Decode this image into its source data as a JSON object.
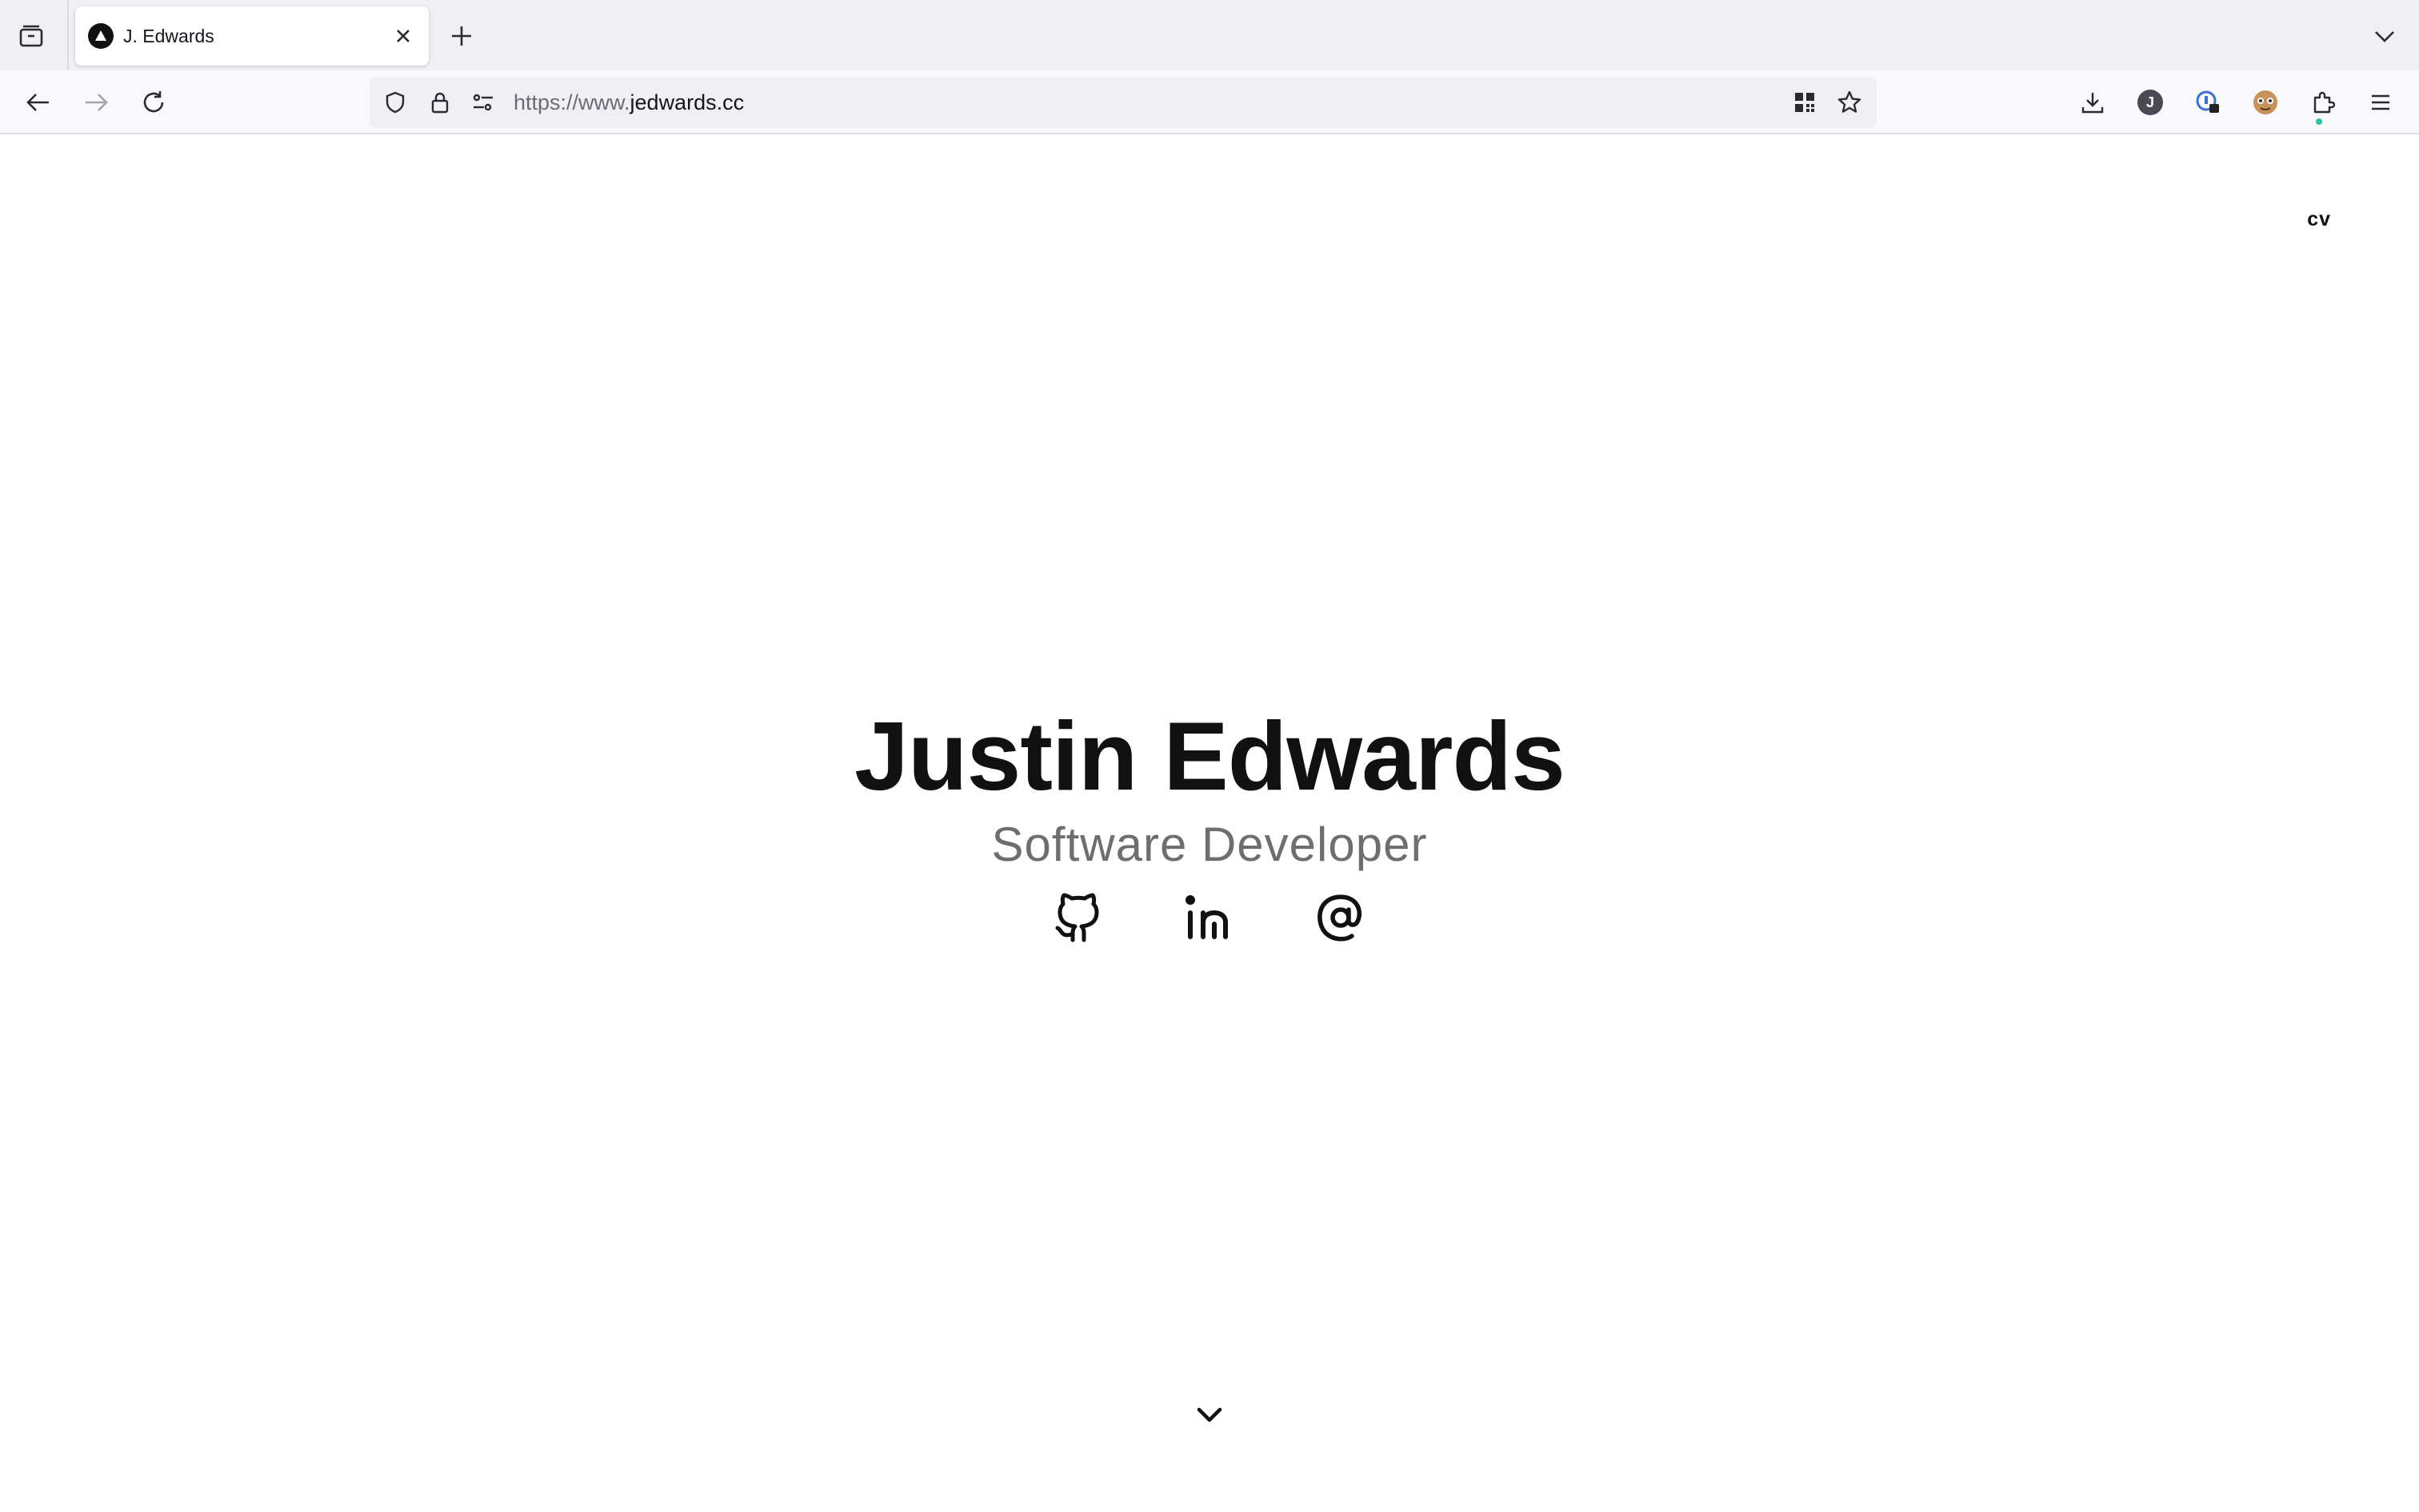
{
  "browser": {
    "tab": {
      "title": "J. Edwards",
      "favicon": "triangle-logo-icon"
    },
    "url": {
      "prefix": "https://www.",
      "domain": "jedwards.cc"
    },
    "icons": {
      "tab_list": "tab-list-icon",
      "close_tab": "close-icon",
      "new_tab": "plus-icon",
      "tab_overflow": "chevron-down-icon",
      "back": "arrow-left-icon",
      "forward": "arrow-right-icon",
      "reload": "reload-icon",
      "tracking_protection": "shield-icon",
      "secure": "lock-icon",
      "permissions": "permissions-icon",
      "qr_code": "qr-code-icon",
      "bookmark": "star-icon",
      "downloads": "download-icon",
      "account": "account-avatar",
      "extension": "password-extension-icon",
      "profile": "profile-avatar",
      "extensions": "puzzle-icon",
      "menu": "hamburger-menu-icon"
    },
    "account_initial": "J"
  },
  "page": {
    "cv_link": "cv",
    "name": "Justin Edwards",
    "role": "Software Developer",
    "socials": [
      {
        "name": "github-icon"
      },
      {
        "name": "linkedin-icon"
      },
      {
        "name": "email-at-icon"
      }
    ],
    "scroll_hint": "chevron-down-icon"
  },
  "colors": {
    "text_primary": "#111111",
    "text_secondary": "#6e6e6e",
    "chrome_bg": "#f0f0f4",
    "toolbar_bg": "#f9f9fb",
    "accent_dot": "#2ac3a2"
  }
}
